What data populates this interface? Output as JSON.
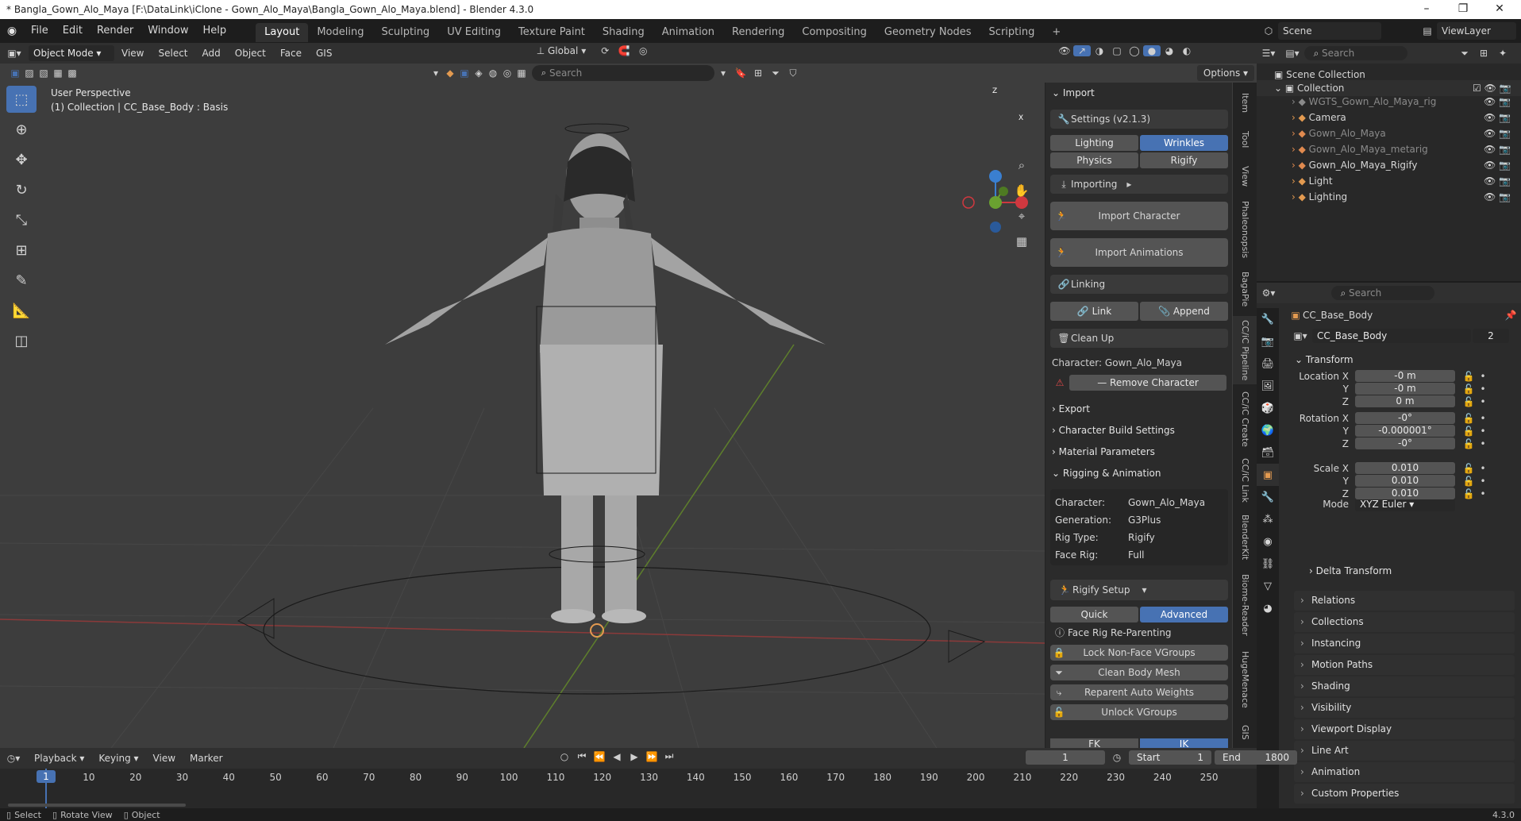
{
  "window": {
    "title": "* Bangla_Gown_Alo_Maya [F:\\DataLink\\iClone - Gown_Alo_Maya\\Bangla_Gown_Alo_Maya.blend] - Blender 4.3.0",
    "minimize": "–",
    "maximize": "❐",
    "close": "✕"
  },
  "menu": {
    "items": [
      "File",
      "Edit",
      "Render",
      "Window",
      "Help"
    ],
    "workspaces": [
      "Layout",
      "Modeling",
      "Sculpting",
      "UV Editing",
      "Texture Paint",
      "Shading",
      "Animation",
      "Rendering",
      "Compositing",
      "Geometry Nodes",
      "Scripting"
    ],
    "add_tab": "+",
    "scene_label": "Scene",
    "viewlayer_label": "ViewLayer"
  },
  "viewport_header": {
    "mode": "Object Mode",
    "menus": [
      "View",
      "Select",
      "Add",
      "Object",
      "Face",
      "GIS"
    ],
    "orientation": "Global",
    "options": "Options",
    "search_placeholder": "Search"
  },
  "viewport": {
    "perspective": "User Perspective",
    "collection_info": "(1) Collection | CC_Base_Body : Basis",
    "axes": {
      "z": "Z",
      "y": "Y",
      "x": "X"
    }
  },
  "npanel": {
    "import_header": "Import",
    "settings": "Settings  (v2.1.3)",
    "lighting": "Lighting",
    "wrinkles": "Wrinkles",
    "physics": "Physics",
    "rigify": "Rigify",
    "importing": "Importing",
    "import_character": "Import Character",
    "import_animations": "Import Animations",
    "linking": "Linking",
    "link": "Link",
    "append": "Append",
    "clean_up": "Clean Up",
    "character_label": "Character: Gown_Alo_Maya",
    "remove_character": "Remove Character",
    "export": "Export",
    "char_build": "Character Build Settings",
    "material_params": "Material Parameters",
    "rigging": "Rigging & Animation",
    "info": [
      {
        "k": "Character:",
        "v": "Gown_Alo_Maya"
      },
      {
        "k": "Generation:",
        "v": "G3Plus"
      },
      {
        "k": "Rig Type:",
        "v": "Rigify"
      },
      {
        "k": "Face Rig:",
        "v": "Full"
      }
    ],
    "rigify_setup": "Rigify Setup",
    "quick": "Quick",
    "advanced": "Advanced",
    "face_rig_reparent": "Face Rig Re-Parenting",
    "lock_vgroups": "Lock Non-Face VGroups",
    "clean_body": "Clean Body Mesh",
    "reparent_weights": "Reparent Auto Weights",
    "unlock_vgroups": "Unlock VGroups",
    "fk": "FK",
    "ik": "IK",
    "tabs": [
      "Item",
      "Tool",
      "View",
      "Phaleonopsis",
      "BagaPie",
      "CC/iC Pipeline",
      "CC/iC Create",
      "CC/iC Link",
      "BlenderKit",
      "Biome-Reader",
      "HugeMenace",
      "GIS"
    ]
  },
  "outliner": {
    "search_placeholder": "Search",
    "root": "Scene Collection",
    "collection": "Collection",
    "items": [
      {
        "name": "WGTS_Gown_Alo_Maya_rig",
        "dim": true,
        "color": "#8a8a8a"
      },
      {
        "name": "Camera",
        "dim": false,
        "color": "#e39a50"
      },
      {
        "name": "Gown_Alo_Maya",
        "dim": true,
        "color": "#e08a4f"
      },
      {
        "name": "Gown_Alo_Maya_metarig",
        "dim": true,
        "color": "#e08a4f"
      },
      {
        "name": "Gown_Alo_Maya_Rigify",
        "dim": false,
        "color": "#e08a4f"
      },
      {
        "name": "Light",
        "dim": false,
        "color": "#e39a50"
      },
      {
        "name": "Lighting",
        "dim": false,
        "color": "#e39a50"
      }
    ]
  },
  "properties": {
    "search_placeholder": "Search",
    "object_name": "CC_Base_Body",
    "data_name": "CC_Base_Body",
    "users": "2",
    "transform": "Transform",
    "location": [
      {
        "label": "Location X",
        "value": "-0 m"
      },
      {
        "label": "Y",
        "value": "-0 m"
      },
      {
        "label": "Z",
        "value": "0 m"
      }
    ],
    "rotation": [
      {
        "label": "Rotation X",
        "value": "-0°"
      },
      {
        "label": "Y",
        "value": "-0.000001°"
      },
      {
        "label": "Z",
        "value": "-0°"
      }
    ],
    "mode_label": "Mode",
    "mode_value": "XYZ Euler",
    "scale": [
      {
        "label": "Scale X",
        "value": "0.010"
      },
      {
        "label": "Y",
        "value": "0.010"
      },
      {
        "label": "Z",
        "value": "0.010"
      }
    ],
    "delta": "Delta Transform",
    "sections": [
      "Relations",
      "Collections",
      "Instancing",
      "Motion Paths",
      "Shading",
      "Visibility",
      "Viewport Display",
      "Line Art",
      "Animation",
      "Custom Properties"
    ]
  },
  "timeline": {
    "menus": [
      "Playback",
      "Keying",
      "View",
      "Marker"
    ],
    "current_frame": "1",
    "start_label": "Start",
    "start": "1",
    "end_label": "End",
    "end": "1800",
    "ticks": [
      "1",
      "10",
      "20",
      "30",
      "40",
      "50",
      "60",
      "70",
      "80",
      "90",
      "100",
      "110",
      "120",
      "130",
      "140",
      "150",
      "160",
      "170",
      "180",
      "190",
      "200",
      "210",
      "220",
      "230",
      "240",
      "250"
    ]
  },
  "status": {
    "select": "Select",
    "rotate": "Rotate View",
    "object": "Object",
    "version": "4.3.0"
  }
}
